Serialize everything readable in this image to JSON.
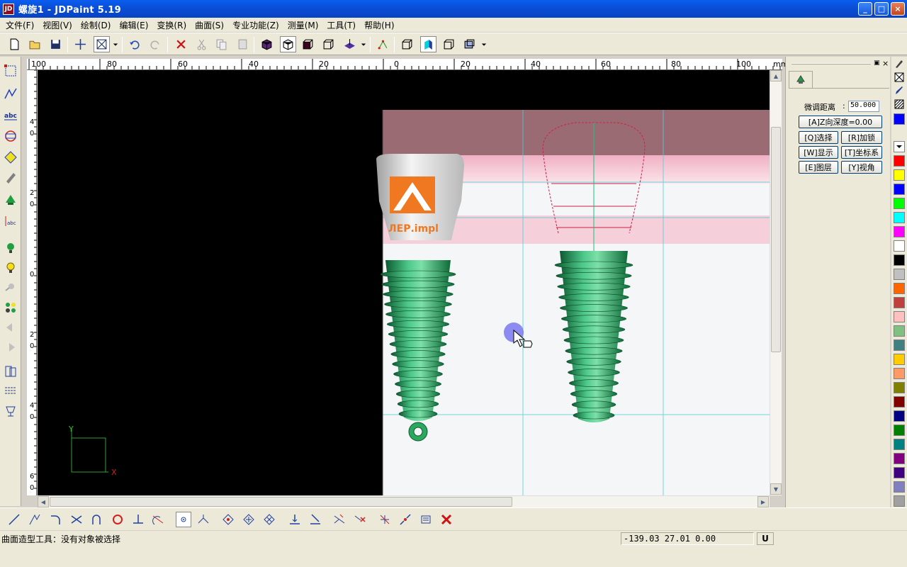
{
  "window": {
    "app_icon_text": "JD",
    "title": "螺旋1 - JDPaint 5.19",
    "min_label": "_",
    "max_label": "□",
    "close_label": "×"
  },
  "menu": {
    "items": [
      "文件(F)",
      "视图(V)",
      "绘制(D)",
      "编辑(E)",
      "变换(R)",
      "曲面(S)",
      "专业功能(Z)",
      "测量(M)",
      "工具(T)",
      "帮助(H)"
    ]
  },
  "ruler": {
    "h_labels": [
      "100",
      "80",
      "60",
      "40",
      "20",
      "0",
      "20",
      "40",
      "60",
      "80",
      "100"
    ],
    "unit": "mm",
    "v_labels": [
      "4\n0",
      "2\n0",
      "0",
      "2\n0",
      "4\n0",
      "6\n0"
    ]
  },
  "viewport": {
    "logo_text": "ЛЕР.impl",
    "axis_x": "X",
    "axis_y": "Y"
  },
  "panel": {
    "nudge_label": "微调距离",
    "nudge_value": "50.000",
    "z_depth_button": "[A]Z向深度=0.00",
    "select_button": "[Q]选择",
    "lock_button": "[R]加锁",
    "display_button": "[W]显示",
    "coord_button": "[T]坐标系",
    "layer_button": "[E]图层",
    "view_button": "[Y]视角"
  },
  "palette": {
    "colors": [
      "#0000ff",
      "#ff0000",
      "#ffff00",
      "#0000ff",
      "#00ff00",
      "#00ffff",
      "#ff00ff",
      "#ffffff",
      "#000000",
      "#c0c0c0",
      "#ff6600",
      "#c04040",
      "#ffc0c0",
      "#80c080",
      "#408080",
      "#ffcc00",
      "#ff9966",
      "#808000",
      "#800000",
      "#000080",
      "#008000",
      "#008080",
      "#800080",
      "#400080",
      "#8080c0",
      "#a0a0a0"
    ]
  },
  "status": {
    "text": "曲面造型工具：没有对象被选择",
    "coords": "-139.03 27.01 0.00",
    "unit": "U"
  }
}
